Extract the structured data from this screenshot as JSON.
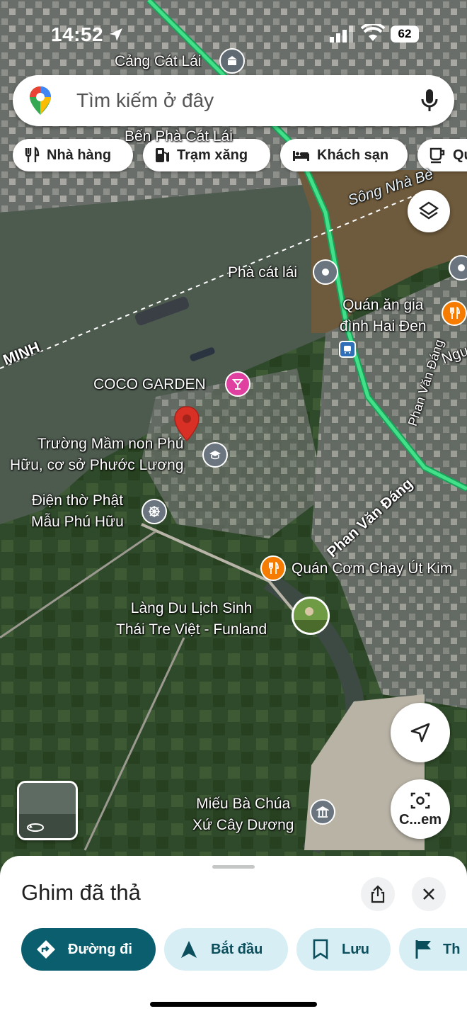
{
  "status": {
    "time": "14:52",
    "battery": "62"
  },
  "search": {
    "placeholder": "Tìm kiếm ở đây"
  },
  "chips": [
    {
      "label": "Nhà hàng",
      "icon": "fork-knife-icon"
    },
    {
      "label": "Trạm xăng",
      "icon": "gas-station-icon"
    },
    {
      "label": "Khách sạn",
      "icon": "bed-icon"
    },
    {
      "label": "Qu",
      "icon": "coffee-cup-icon"
    }
  ],
  "map": {
    "labels": {
      "port": "Cảng Cát Lái",
      "ferry_terminal": "Bến Phà Cát Lái",
      "river": "Sông Nhà Bè",
      "ferry": "Phà cát lái",
      "restaurant_hai_den": "Quán ăn gia\nđình Hai Đen",
      "road_nguyen": "Ngu",
      "city": "MINH",
      "coco_garden": "COCO GARDEN",
      "school": "Trường Mầm non Phú\nHữu, cơ sở Phước Lương",
      "shrine": "Điện thờ Phật\nMẫu Phú Hữu",
      "street_1": "Phan Văn Đáng",
      "street_2": "Phan Văn Đáng",
      "veg_restaurant": "Quán Cơm Chay Út Kim",
      "funland": "Làng Du Lịch Sinh\nThái Tre Việt - Funland",
      "temple": "Miếu Bà Chúa\nXứ Cây Dương"
    },
    "lens_label": "C...em"
  },
  "sheet": {
    "title": "Ghim đã thả",
    "actions": [
      {
        "label": "Đường đi",
        "icon": "directions-icon"
      },
      {
        "label": "Bắt đầu",
        "icon": "navigation-arrow-icon"
      },
      {
        "label": "Lưu",
        "icon": "bookmark-icon"
      },
      {
        "label": "Th",
        "icon": "flag-icon"
      }
    ]
  },
  "colors": {
    "accent": "#0b5e6e",
    "pin_red": "#d93025",
    "food_orange": "#f57c00",
    "route_green": "#2ecc71",
    "poi_gray": "#70757a",
    "coco_pink": "#e040a0"
  }
}
